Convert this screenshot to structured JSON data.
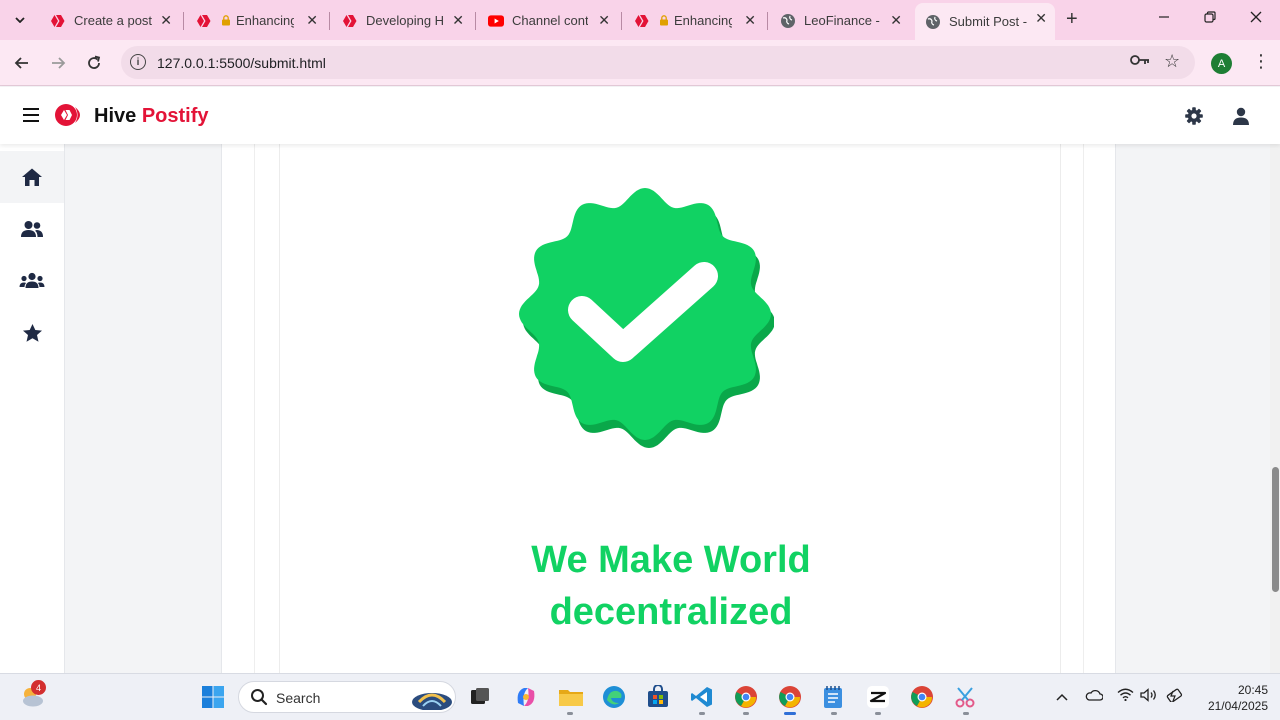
{
  "browser": {
    "tabs": [
      {
        "title": "Create a post",
        "favicon": "hive-logo-icon",
        "active": false
      },
      {
        "title": "Enhancing",
        "favicon": "hive-logo-icon",
        "active": false
      },
      {
        "title": "Developing H",
        "favicon": "hive-logo-icon",
        "active": false
      },
      {
        "title": "Channel conte",
        "favicon": "youtube-icon",
        "active": false
      },
      {
        "title": "Enhancing",
        "favicon": "hive-logo-icon",
        "active": false
      },
      {
        "title": "LeoFinance - I",
        "favicon": "globe-icon",
        "active": false
      },
      {
        "title": "Submit Post -",
        "favicon": "globe-icon",
        "active": true
      }
    ],
    "url": "127.0.0.1:5500/submit.html",
    "profile_initial": "A"
  },
  "app": {
    "brand_part1": "Hive",
    "brand_part2": "Postify",
    "brand_color": "#e31337",
    "sidebar": [
      {
        "icon": "home-icon",
        "active": true
      },
      {
        "icon": "users-icon",
        "active": false
      },
      {
        "icon": "community-icon",
        "active": false
      },
      {
        "icon": "star-icon",
        "active": false
      }
    ]
  },
  "content": {
    "badge_color": "#11d263",
    "headline_line1": "We Make World",
    "headline_line2": "decentralized"
  },
  "taskbar": {
    "search_label": "Search",
    "weather_badge": "4",
    "time": "20:45",
    "date": "21/04/2025"
  }
}
